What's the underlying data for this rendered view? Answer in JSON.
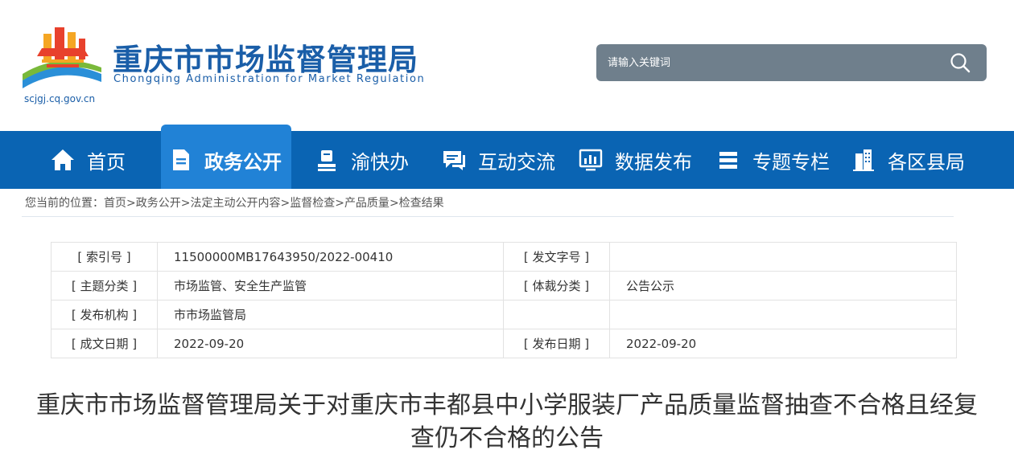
{
  "header": {
    "title": "重庆市市场监督管理局",
    "subtitle": "Chongqing Administration for Market Regulation",
    "domain": "scjgj.cq.gov.cn"
  },
  "search": {
    "placeholder": "请输入关键词"
  },
  "nav": {
    "items": [
      {
        "label": "首页",
        "icon": "home-icon"
      },
      {
        "label": "政务公开",
        "icon": "document-icon",
        "active": true
      },
      {
        "label": "渝快办",
        "icon": "stamp-icon"
      },
      {
        "label": "互动交流",
        "icon": "chat-icon"
      },
      {
        "label": "数据发布",
        "icon": "chart-icon"
      },
      {
        "label": "专题专栏",
        "icon": "list-icon"
      },
      {
        "label": "各区县局",
        "icon": "building-icon"
      }
    ]
  },
  "breadcrumb": {
    "prefix": "您当前的位置：",
    "items": [
      "首页",
      "政务公开",
      "法定主动公开内容",
      "监督检查",
      "产品质量",
      "检查结果"
    ],
    "separator": ">"
  },
  "info": {
    "index_label": "[ 索引号 ]",
    "index_value": "11500000MB17643950/2022-00410",
    "doc_no_label": "[ 发文字号 ]",
    "doc_no_value": "",
    "topic_label": "[ 主题分类 ]",
    "topic_value": "市场监管、安全生产监管",
    "genre_label": "[ 体裁分类 ]",
    "genre_value": "公告公示",
    "publisher_label": "[ 发布机构 ]",
    "publisher_value": "市市场监管局",
    "created_label": "[ 成文日期 ]",
    "created_value": "2022-09-20",
    "published_label": "[ 发布日期 ]",
    "published_value": "2022-09-20"
  },
  "article": {
    "title": "重庆市市场监督管理局关于对重庆市丰都县中小学服装厂产品质量监督抽查不合格且经复查仍不合格的公告"
  },
  "colors": {
    "brand_blue": "#1a5ea8",
    "nav_bg": "#0a64b3",
    "nav_active": "#2182d6",
    "search_bg": "#6f7f8c"
  }
}
